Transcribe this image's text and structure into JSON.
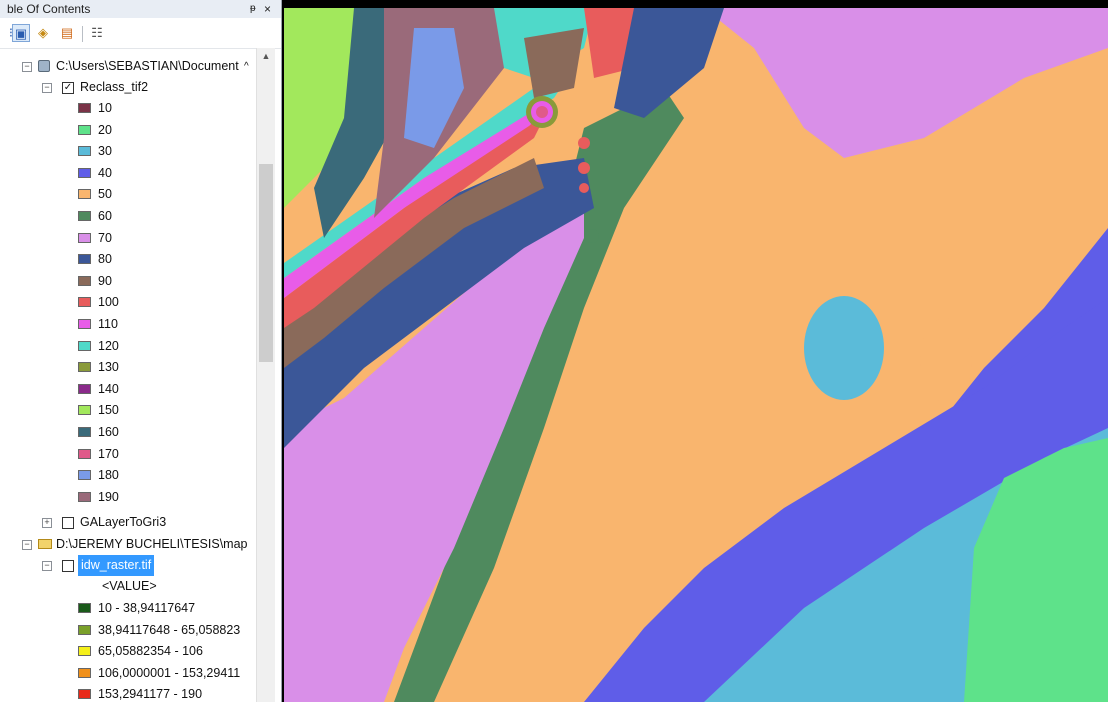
{
  "toc": {
    "title": "ble Of Contents",
    "pin_glyph": "ᵽ",
    "close_glyph": "×",
    "toolbar": {
      "list_by_drawing_order_icon": "list-by-drawing-order-icon",
      "list_by_source_icon": "list-by-source-icon",
      "list_by_visibility_icon": "list-by-visibility-icon",
      "list_by_selection_icon": "list-by-selection-icon",
      "options_icon": "options-icon"
    },
    "group1": {
      "path": "C:\\Users\\SEBASTIAN\\Document",
      "layer": {
        "name": "Reclass_tif2",
        "checked": true,
        "classes": [
          {
            "label": "10",
            "color": "#7a3347"
          },
          {
            "label": "20",
            "color": "#5ee28a"
          },
          {
            "label": "30",
            "color": "#5bbbd9"
          },
          {
            "label": "40",
            "color": "#5f5de8"
          },
          {
            "label": "50",
            "color": "#f9b56e"
          },
          {
            "label": "60",
            "color": "#4f8a5e"
          },
          {
            "label": "70",
            "color": "#d98fe8"
          },
          {
            "label": "80",
            "color": "#3b5798"
          },
          {
            "label": "90",
            "color": "#8a6a5a"
          },
          {
            "label": "100",
            "color": "#e85c5c"
          },
          {
            "label": "110",
            "color": "#e85ce8"
          },
          {
            "label": "120",
            "color": "#4fd9c9"
          },
          {
            "label": "130",
            "color": "#8a9a3a"
          },
          {
            "label": "140",
            "color": "#8a2a8a"
          },
          {
            "label": "150",
            "color": "#a2e85c"
          },
          {
            "label": "160",
            "color": "#3a6a7a"
          },
          {
            "label": "170",
            "color": "#e05a8a"
          },
          {
            "label": "180",
            "color": "#7a9ae8"
          },
          {
            "label": "190",
            "color": "#9a6a7a"
          }
        ]
      },
      "layer2": {
        "name": "GALayerToGri3",
        "checked": false
      }
    },
    "group2": {
      "path": "D:\\JEREMY BUCHELI\\TESIS\\map",
      "layer": {
        "name": "idw_raster.tif",
        "checked": false,
        "field": "<VALUE>",
        "classes": [
          {
            "label": "10 - 38,94117647",
            "color": "#1a5a1a"
          },
          {
            "label": "38,94117648 - 65,058823",
            "color": "#7aa02a"
          },
          {
            "label": "65,05882354 - 106",
            "color": "#f5f01a"
          },
          {
            "label": "106,0000001 - 153,29411",
            "color": "#f0901a"
          },
          {
            "label": "153,2941177 - 190",
            "color": "#e82a1a"
          }
        ]
      }
    }
  },
  "map": {
    "frame_name": "data-frame"
  }
}
